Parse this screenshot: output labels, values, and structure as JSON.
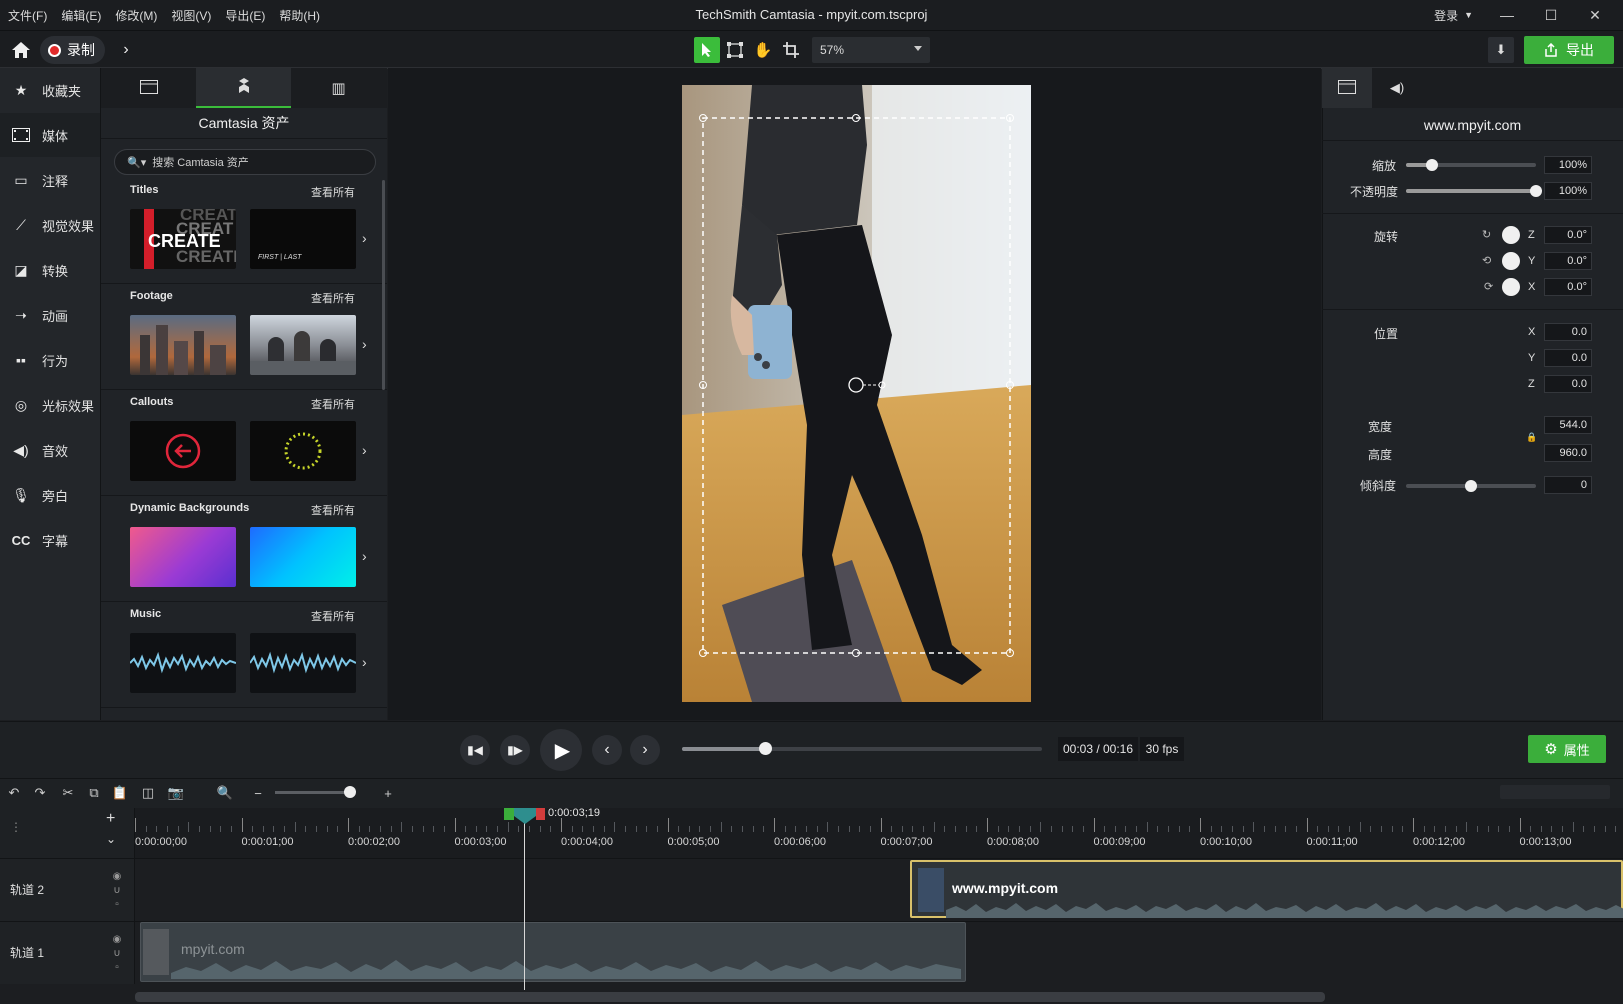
{
  "menubar": {
    "items": [
      "文件(F)",
      "编辑(E)",
      "修改(M)",
      "视图(V)",
      "导出(E)",
      "帮助(H)"
    ],
    "title": "TechSmith Camtasia - mpyit.com.tscproj",
    "login": "登录"
  },
  "toolbar": {
    "record_label": "录制",
    "zoom_value": "57%",
    "export_label": "导出"
  },
  "leftnav": {
    "items": [
      {
        "label": "收藏夹",
        "icon": "star-icon"
      },
      {
        "label": "媒体",
        "icon": "film-icon"
      },
      {
        "label": "注释",
        "icon": "annotation-icon"
      },
      {
        "label": "视觉效果",
        "icon": "wand-icon"
      },
      {
        "label": "转换",
        "icon": "transition-icon"
      },
      {
        "label": "动画",
        "icon": "animation-icon"
      },
      {
        "label": "行为",
        "icon": "behavior-icon"
      },
      {
        "label": "光标效果",
        "icon": "cursor-icon"
      },
      {
        "label": "音效",
        "icon": "speaker-icon"
      },
      {
        "label": "旁白",
        "icon": "microphone-icon"
      },
      {
        "label": "字幕",
        "icon": "cc-icon"
      }
    ]
  },
  "assets": {
    "title": "Camtasia 资产",
    "search_placeholder": "搜索 Camtasia 资产",
    "see_all": "查看所有",
    "sections": [
      {
        "title": "Titles"
      },
      {
        "title": "Footage"
      },
      {
        "title": "Callouts"
      },
      {
        "title": "Dynamic Backgrounds"
      },
      {
        "title": "Music"
      }
    ],
    "titles_thumb_text": "CREATE",
    "titles_thumb2_text": "FIRST | LAST"
  },
  "properties": {
    "title": "www.mpyit.com",
    "scale_label": "缩放",
    "scale_value": "100%",
    "opacity_label": "不透明度",
    "opacity_value": "100%",
    "rotation_label": "旋转",
    "rot_z": "0.0°",
    "rot_y": "0.0°",
    "rot_x": "0.0°",
    "position_label": "位置",
    "pos_x": "0.0",
    "pos_y": "0.0",
    "pos_z": "0.0",
    "width_label": "宽度",
    "width_value": "544.0",
    "height_label": "高度",
    "height_value": "960.0",
    "skew_label": "倾斜度",
    "skew_value": "0",
    "axis_z": "Z",
    "axis_y": "Y",
    "axis_x": "X",
    "scale_level": 0.2,
    "opacity_level": 1.0,
    "skew_level": 0.5
  },
  "playback": {
    "time": "00:03 / 00:16",
    "fps": "30 fps",
    "progress": 0.23,
    "props_label": "属性"
  },
  "timeline": {
    "playhead_time": "0:00:03;19",
    "ruler": [
      "0:00:00;00",
      "0:00:01;00",
      "0:00:02;00",
      "0:00:03;00",
      "0:00:04;00",
      "0:00:05;00",
      "0:00:06;00",
      "0:00:07;00",
      "0:00:08;00",
      "0:00:09;00",
      "0:00:10;00",
      "0:00:11;00",
      "0:00:12;00",
      "0:00:13;00"
    ],
    "tracks": [
      {
        "name": "轨道 2",
        "clip": "www.mpyit.com"
      },
      {
        "name": "轨道 1",
        "clip": "mpyit.com"
      }
    ]
  },
  "colors": {
    "accent": "#3bae3b",
    "clip_selected_border": "#d9c16a",
    "record": "#e22b2b"
  }
}
